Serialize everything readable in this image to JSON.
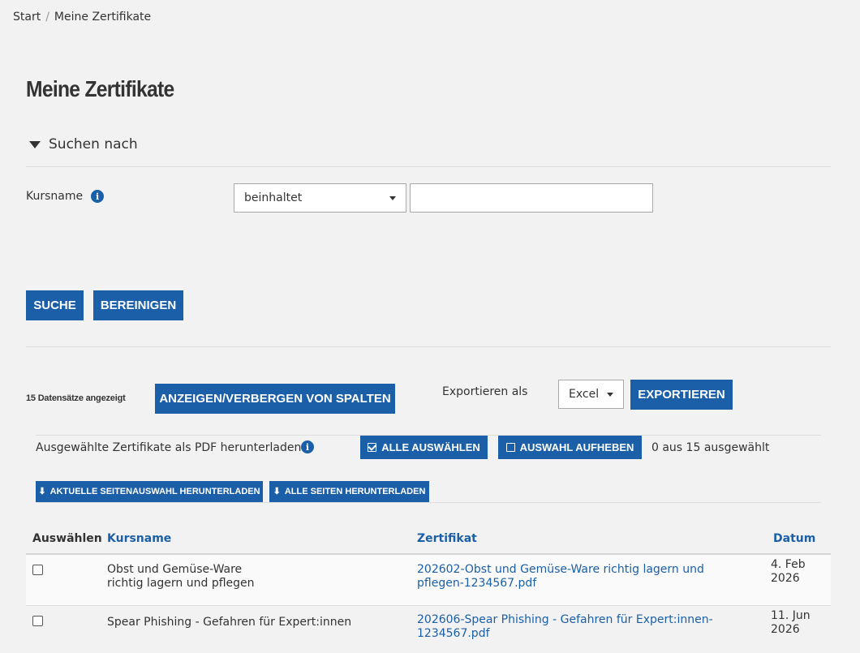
{
  "breadcrumb": {
    "home": "Start",
    "separator": "/",
    "current": "Meine Zertifikate"
  },
  "page_title": "Meine Zertifikate",
  "search": {
    "toggle_label": "Suchen nach",
    "field_label": "Kursname",
    "operator_value": "beinhaltet",
    "input_value": "",
    "search_button": "SUCHE",
    "clear_button": "BEREINIGEN"
  },
  "toolbar": {
    "records_count": "15 Datensätze angezeigt",
    "toggle_columns_button": "ANZEIGEN/VERBERGEN VON SPALTEN",
    "export_label": "Exportieren als",
    "export_format": "Excel",
    "export_button": "EXPORTIEREN"
  },
  "download": {
    "label": "Ausgewählte Zertifikate als PDF herunterladen",
    "select_all": "ALLE AUSWÄHLEN",
    "deselect": "AUSWAHL AUFHEBEN",
    "selected_count": "0 aus 15 ausgewählt",
    "current_page_button": "AKTUELLE SEITENAUSWAHL HERUNTERLADEN",
    "all_pages_button": "ALLE SEITEN HERUNTERLADEN"
  },
  "table": {
    "headers": {
      "select": "Auswählen",
      "course": "Kursname",
      "certificate": "Zertifikat",
      "date": "Datum"
    },
    "rows": [
      {
        "course_line1": "Obst und Gemüse-Ware",
        "course_line2": "richtig lagern und pflegen",
        "cert_line1": "202602-Obst und Gemüse-Ware richtig lagern und",
        "cert_line2": "pflegen-1234567.pdf",
        "date_line1": "4. Feb",
        "date_line2": "2026"
      },
      {
        "course_line1": "Spear Phishing - Gefahren für Expert:innen",
        "course_line2": "",
        "cert_line1": "202606-Spear Phishing - Gefahren für Expert:innen-",
        "cert_line2": "1234567.pdf",
        "date_line1": "11. Jun",
        "date_line2": "2026"
      }
    ]
  },
  "colors": {
    "primary": "#1b5fa8",
    "background": "#f2f2f2",
    "text": "#333333"
  }
}
